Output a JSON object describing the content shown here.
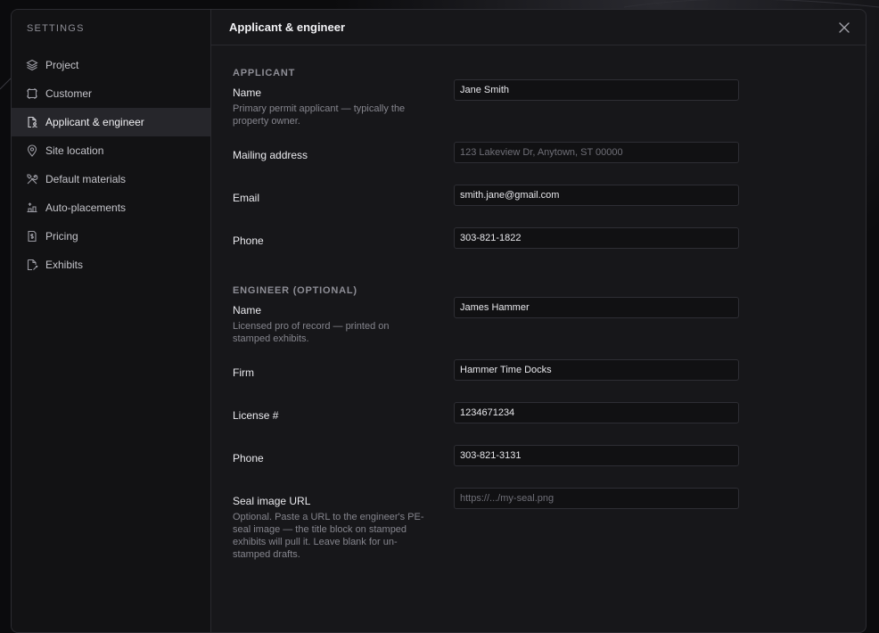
{
  "sidebar": {
    "title": "SETTINGS",
    "items": [
      {
        "label": "Project",
        "icon": "layers-icon"
      },
      {
        "label": "Customer",
        "icon": "frame-icon"
      },
      {
        "label": "Applicant & engineer",
        "icon": "user-document-icon"
      },
      {
        "label": "Site location",
        "icon": "map-pin-icon"
      },
      {
        "label": "Default materials",
        "icon": "tools-icon"
      },
      {
        "label": "Auto-placements",
        "icon": "auto-placement-icon"
      },
      {
        "label": "Pricing",
        "icon": "receipt-icon"
      },
      {
        "label": "Exhibits",
        "icon": "exhibit-icon"
      }
    ],
    "active_index": 2
  },
  "header": {
    "title": "Applicant & engineer",
    "close_icon": "close-icon"
  },
  "applicant": {
    "section_title": "APPLICANT",
    "name_label": "Name",
    "name_help": "Primary permit applicant — typically the property owner.",
    "name_value": "Jane Smith",
    "address_label": "Mailing address",
    "address_placeholder": "123 Lakeview Dr, Anytown, ST 00000",
    "address_value": "",
    "email_label": "Email",
    "email_value": "smith.jane@gmail.com",
    "phone_label": "Phone",
    "phone_value": "303-821-1822"
  },
  "engineer": {
    "section_title": "ENGINEER (OPTIONAL)",
    "name_label": "Name",
    "name_help": "Licensed pro of record — printed on stamped exhibits.",
    "name_value": "James Hammer",
    "firm_label": "Firm",
    "firm_value": "Hammer Time Docks",
    "license_label": "License #",
    "license_value": "1234671234",
    "phone_label": "Phone",
    "phone_value": "303-821-3131",
    "seal_label": "Seal image URL",
    "seal_help": "Optional. Paste a URL to the engineer's PE-seal image — the title block on stamped exhibits will pull it. Leave blank for un-stamped drafts.",
    "seal_placeholder": "https://.../my-seal.png",
    "seal_value": ""
  },
  "colors": {
    "background": "#0b0b0d",
    "dialog": "#17171a",
    "sidebar": "#121214",
    "active_item": "#26262b",
    "input": "#111113"
  }
}
